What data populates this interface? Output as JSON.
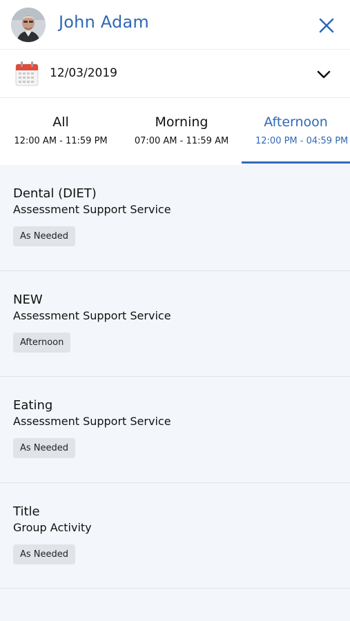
{
  "header": {
    "name": "John Adam",
    "avatar_icon": "user-avatar-photo",
    "close_icon": "close-icon",
    "accent_color": "#2f68b6"
  },
  "date": {
    "value": "12/03/2019",
    "calendar_icon": "calendar-icon",
    "toggle_icon": "chevron-down-icon"
  },
  "tabs": [
    {
      "label": "All",
      "range": "12:00 AM - 11:59 PM",
      "active": false
    },
    {
      "label": "Morning",
      "range": "07:00 AM - 11:59 AM",
      "active": false
    },
    {
      "label": "Afternoon",
      "range": "12:00 PM - 04:59 PM",
      "active": true
    }
  ],
  "items": [
    {
      "title": "Dental (DIET)",
      "subtitle": "Assessment Support Service",
      "badge": "As Needed"
    },
    {
      "title": "NEW",
      "subtitle": "Assessment Support Service",
      "badge": "Afternoon"
    },
    {
      "title": "Eating",
      "subtitle": "Assessment Support Service",
      "badge": "As Needed"
    },
    {
      "title": "Title",
      "subtitle": "Group Activity",
      "badge": "As Needed"
    }
  ]
}
